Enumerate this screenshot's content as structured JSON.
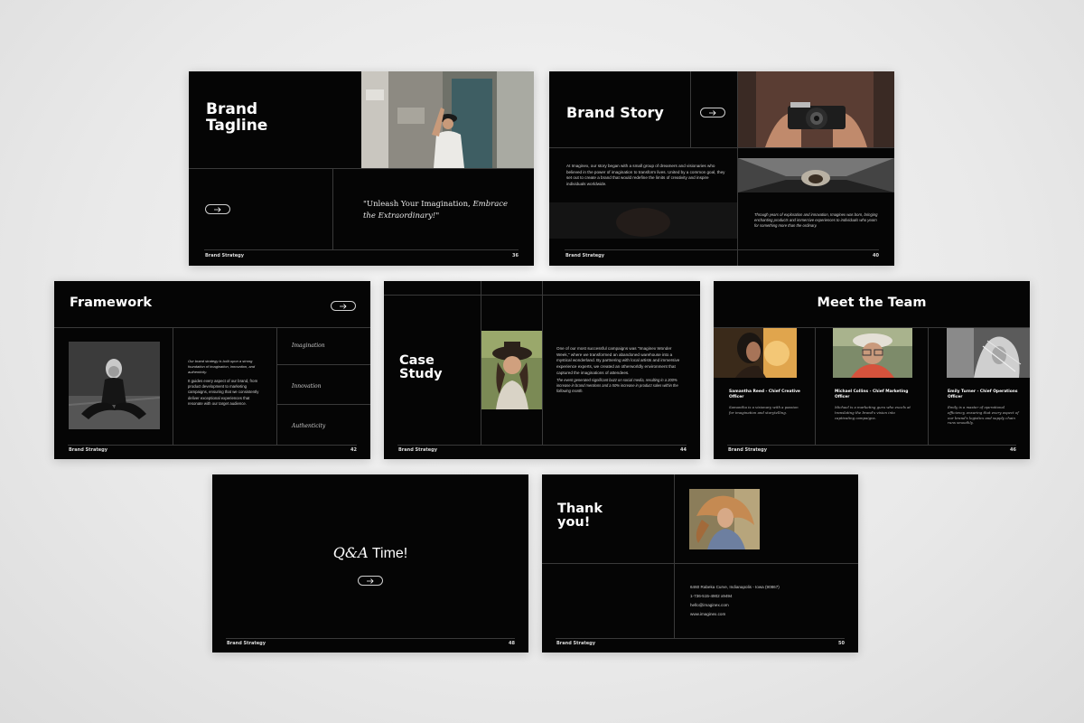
{
  "footer_brand": "Brand Strategy",
  "slides": {
    "tagline": {
      "title_line1": "Brand",
      "title_line2": "Tagline",
      "quote_plain": "\"Unleash Your Imagination, ",
      "quote_italic": "Embrace the Extraordinary!",
      "quote_end": "\"",
      "page": "36"
    },
    "story": {
      "title": "Brand Story",
      "body": "At Imaginex, our story began with a small group of dreamers and visionaries who believed in the power of imagination to transform lives. United by a common goal, they set out to create a brand that would redefine the limits of creativity and inspire individuals worldwide.",
      "caption": "Through years of exploration and innovation, Imaginex was born, bringing enchanting products and immersive experiences to individuals who yearn for something more than the ordinary.",
      "page": "40"
    },
    "framework": {
      "title": "Framework",
      "intro_italic": "Our brand strategy is built upon a strong foundation of imagination, innovation, and authenticity.",
      "body": "It guides every aspect of our brand, from product development to marketing campaigns, ensuring that we consistently deliver exceptional experiences that resonate with our target audience.",
      "pillars": [
        "Imagination",
        "Innovation",
        "Authenticity"
      ],
      "page": "42"
    },
    "case": {
      "title_line1": "Case",
      "title_line2": "Study",
      "body": "One of our most successful campaigns was \"Imaginex Wonder Week,\" where we transformed an abandoned warehouse into a mystical wonderland. By partnering with local artists and immersive experience experts, we created an otherworldly environment that captured the imaginations of attendees.",
      "italic": "The event generated significant buzz on social media, resulting in a 200% increase in brand mentions and a 50% increase in product sales within the following month.",
      "page": "44"
    },
    "team": {
      "title": "Meet the Team",
      "members": [
        {
          "name": "Samantha Reed - Chief Creative Officer",
          "bio": "Samantha is a visionary with a passion for imagination and storytelling."
        },
        {
          "name": "Michael Collins - Chief Marketing Officer",
          "bio": "Michael is a marketing guru who excels at translating the brand's vision into captivating campaigns."
        },
        {
          "name": "Emily Turner - Chief Operations Officer",
          "bio": "Emily is a master of operational efficiency, ensuring that every aspect of our brand's logistics and supply chain runs smoothly."
        }
      ],
      "page": "46"
    },
    "qa": {
      "title_italic": "Q&A",
      "title_plain": " Time!",
      "page": "48"
    },
    "thanks": {
      "title_line1": "Thank",
      "title_line2": "you!",
      "address": "6460 Rabeka Curve, Indianapolis - Iowa (90867)",
      "phone": "1-736-515-4902 x9494",
      "email": "hello@imaginex.com",
      "website": "www.imaginex.com",
      "page": "50"
    }
  },
  "colors": {
    "slide_bg": "#050505",
    "divider": "#3a3a3a",
    "page_bg": "#ededed"
  },
  "icons": [
    "arrow-right-icon"
  ]
}
